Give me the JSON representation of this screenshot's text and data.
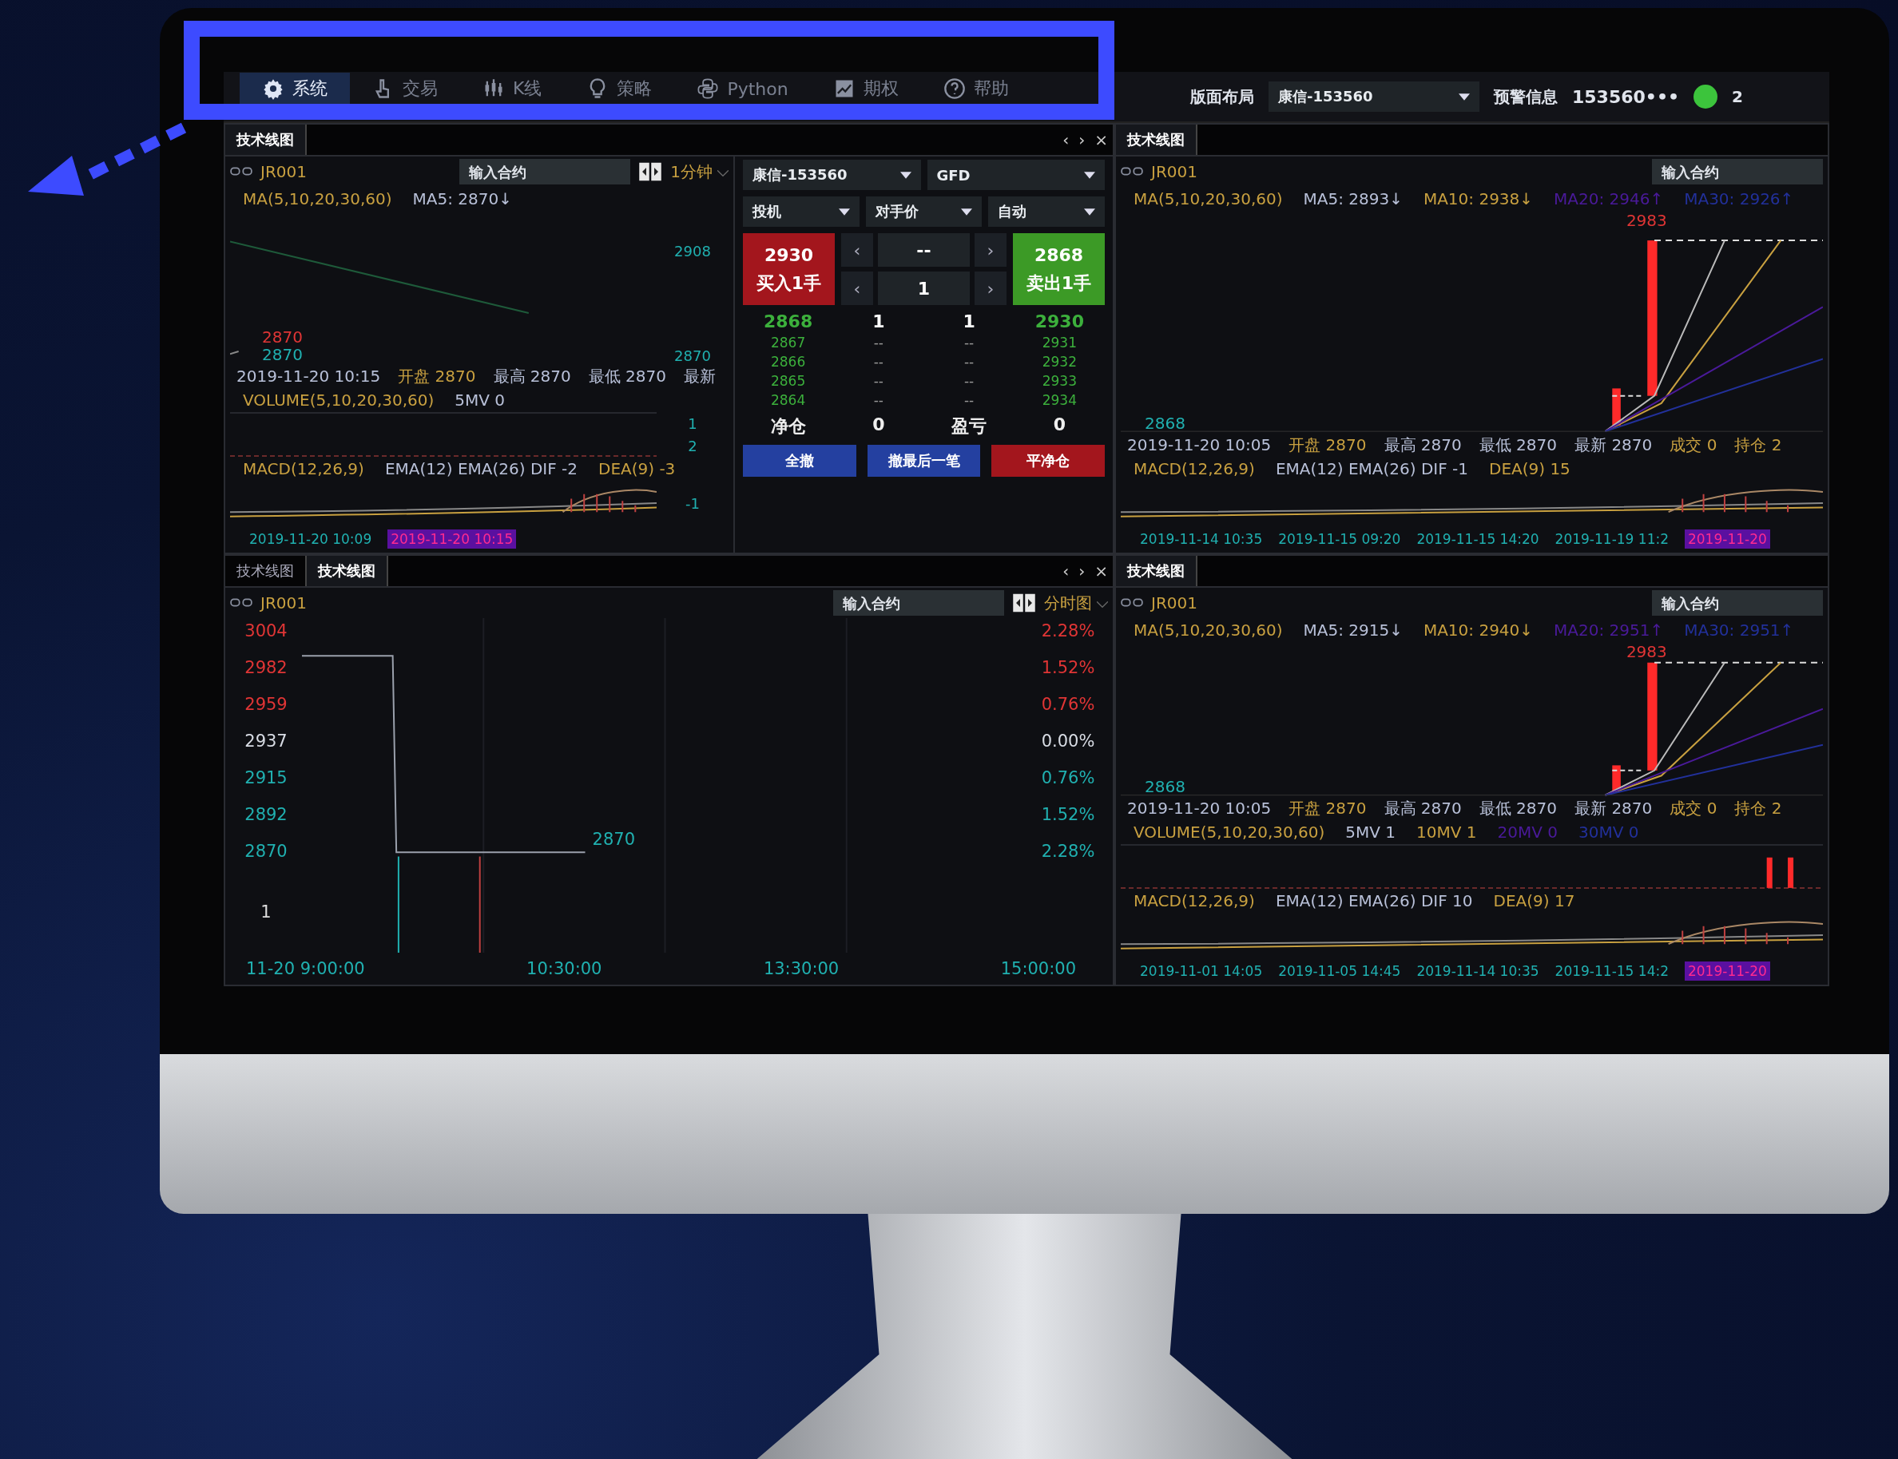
{
  "menu": [
    {
      "label": "系统",
      "selected": true
    },
    {
      "label": "交易",
      "selected": false
    },
    {
      "label": "K线",
      "selected": false
    },
    {
      "label": "策略",
      "selected": false
    },
    {
      "label": "Python",
      "selected": false
    },
    {
      "label": "期权",
      "selected": false
    },
    {
      "label": "帮助",
      "selected": false
    }
  ],
  "toolbar": {
    "layout": "版面布局",
    "account": "康信-153560",
    "alerts": "预警信息",
    "user": "153560•••",
    "overflow": "2"
  },
  "sections": [
    {
      "tabs": [
        {
          "label": "技术线图",
          "selected": true
        }
      ],
      "nav": [
        "‹",
        "›",
        "×"
      ],
      "chart": {
        "symbol": "JR001",
        "placeholder": "输入合约",
        "period": "1分钟",
        "legend": [
          {
            "text": "MA(5,10,20,30,60)",
            "color": "#c8a040"
          },
          {
            "text": "MA5: 2870↓",
            "color": "#b8c0d8"
          }
        ],
        "marks": [
          {
            "text": "2870",
            "color": "#e03535"
          },
          {
            "text": "2870",
            "color": "#20b0b0"
          }
        ],
        "price_axis": [
          "2908",
          "2870"
        ],
        "info": [
          {
            "text": "2019-11-20 10:15",
            "color": "#b8c0d8"
          },
          {
            "text": "开盘 2870",
            "color": "#c8a040"
          },
          {
            "text": "最高 2870",
            "color": "#b8c0d8"
          },
          {
            "text": "最低 2870",
            "color": "#b8c0d8"
          },
          {
            "text": "最新",
            "color": "#b8c0d8"
          }
        ],
        "volume_legend": [
          {
            "text": "VOLUME(5,10,20,30,60)",
            "color": "#c8a040"
          },
          {
            "text": "5MV 0",
            "color": "#b8c0d8"
          }
        ],
        "volume_axis": [
          "1",
          "2"
        ],
        "macd_legend": [
          {
            "text": "MACD(12,26,9)",
            "color": "#c8a040"
          },
          {
            "text": "EMA(12) EMA(26) DIF -2",
            "color": "#b8c0d8"
          },
          {
            "text": "DEA(9) -3",
            "color": "#c8a040"
          }
        ],
        "macd_axis": [
          "-1"
        ],
        "x_labels": [
          {
            "text": "2019-11-20 10:09",
            "selected": false
          },
          {
            "text": "2019-11-20 10:15",
            "selected": true
          }
        ]
      },
      "order": {
        "select_rows": [
          [
            "康信-153560",
            "GFD"
          ],
          [
            "投机",
            "对手价",
            "自动"
          ]
        ],
        "buy": {
          "price": "2930",
          "label": "买入1手"
        },
        "sell": {
          "price": "2868",
          "label": "卖出1手"
        },
        "steppers": [
          {
            "dec": "‹",
            "value": "--",
            "inc": "›"
          },
          {
            "dec": "‹",
            "value": "1",
            "inc": "›"
          }
        ],
        "depth": [
          [
            "2868",
            "1",
            "1",
            "2930"
          ],
          [
            "2867",
            "--",
            "--",
            "2931"
          ],
          [
            "2866",
            "--",
            "--",
            "2932"
          ],
          [
            "2865",
            "--",
            "--",
            "2933"
          ],
          [
            "2864",
            "--",
            "--",
            "2934"
          ]
        ],
        "position": [
          {
            "label": "净仓",
            "value": "0"
          },
          {
            "label": "盈亏",
            "value": "0"
          }
        ],
        "actions": [
          {
            "label": "全撤",
            "kind": "cancel"
          },
          {
            "label": "撤最后一笔",
            "kind": "cancel"
          },
          {
            "label": "平净仓",
            "kind": "close"
          }
        ]
      }
    },
    {
      "tabs": [
        {
          "label": "技术线图",
          "selected": true
        }
      ],
      "chart": {
        "symbol": "JR001",
        "placeholder": "输入合约",
        "legend": [
          {
            "text": "MA(5,10,20,30,60)",
            "color": "#c8a040"
          },
          {
            "text": "MA5: 2893↓",
            "color": "#b8c0d8"
          },
          {
            "text": "MA10: 2938↓",
            "color": "#c8a040"
          },
          {
            "text": "MA20: 2946↑",
            "color": "#4a1a9a"
          },
          {
            "text": "MA30: 2926↑",
            "color": "#22309a"
          }
        ],
        "marks": [
          {
            "text": "2983",
            "color": "#e03535"
          },
          {
            "text": "2868",
            "color": "#20b0b0"
          }
        ],
        "info": [
          {
            "text": "2019-11-20 10:05",
            "color": "#b8c0d8"
          },
          {
            "text": "开盘 2870",
            "color": "#c8a040"
          },
          {
            "text": "最高 2870",
            "color": "#b8c0d8"
          },
          {
            "text": "最低 2870",
            "color": "#b8c0d8"
          },
          {
            "text": "最新 2870",
            "color": "#b8c0d8"
          },
          {
            "text": "成交 0",
            "color": "#c8a040"
          },
          {
            "text": "持仓 2",
            "color": "#c8a040"
          }
        ],
        "macd_legend": [
          {
            "text": "MACD(12,26,9)",
            "color": "#c8a040"
          },
          {
            "text": "EMA(12) EMA(26) DIF -1",
            "color": "#b8c0d8"
          },
          {
            "text": "DEA(9) 15",
            "color": "#c8a040"
          }
        ],
        "x_labels": [
          {
            "text": "2019-11-14 10:35",
            "selected": false
          },
          {
            "text": "2019-11-15 09:20",
            "selected": false
          },
          {
            "text": "2019-11-15 14:20",
            "selected": false
          },
          {
            "text": "2019-11-19 11:2",
            "selected": false
          },
          {
            "text": "2019-11-20",
            "selected": true
          }
        ]
      }
    },
    {
      "tabs": [
        {
          "label": "技术线图",
          "selected": false
        },
        {
          "label": "技术线图",
          "selected": true
        }
      ],
      "nav": [
        "‹",
        "›",
        "×"
      ],
      "timeshare": {
        "symbol": "JR001",
        "placeholder": "输入合约",
        "period": "分时图",
        "left_axis": [
          {
            "text": "3004",
            "color": "#e03535"
          },
          {
            "text": "2982",
            "color": "#e03535"
          },
          {
            "text": "2959",
            "color": "#e03535"
          },
          {
            "text": "2937",
            "color": "#d8dce4"
          },
          {
            "text": "2915",
            "color": "#20b0b0"
          },
          {
            "text": "2892",
            "color": "#20b0b0"
          },
          {
            "text": "2870",
            "color": "#20b0b0"
          }
        ],
        "right_axis": [
          {
            "text": "2.28%",
            "color": "#e03535"
          },
          {
            "text": "1.52%",
            "color": "#e03535"
          },
          {
            "text": "0.76%",
            "color": "#e03535"
          },
          {
            "text": "0.00%",
            "color": "#d8dce4"
          },
          {
            "text": "0.76%",
            "color": "#20b0b0"
          },
          {
            "text": "1.52%",
            "color": "#20b0b0"
          },
          {
            "text": "2.28%",
            "color": "#20b0b0"
          }
        ],
        "last_mark": "2870",
        "volume_axis": "1",
        "x_labels": [
          "11-20 9:00:00",
          "10:30:00",
          "13:30:00",
          "15:00:00"
        ]
      }
    },
    {
      "tabs": [
        {
          "label": "技术线图",
          "selected": true
        }
      ],
      "chart": {
        "symbol": "JR001",
        "placeholder": "输入合约",
        "legend": [
          {
            "text": "MA(5,10,20,30,60)",
            "color": "#c8a040"
          },
          {
            "text": "MA5: 2915↓",
            "color": "#b8c0d8"
          },
          {
            "text": "MA10: 2940↓",
            "color": "#c8a040"
          },
          {
            "text": "MA20: 2951↑",
            "color": "#4a1a9a"
          },
          {
            "text": "MA30: 2951↑",
            "color": "#22309a"
          }
        ],
        "marks": [
          {
            "text": "2983",
            "color": "#e03535"
          },
          {
            "text": "2868",
            "color": "#20b0b0"
          }
        ],
        "info": [
          {
            "text": "2019-11-20 10:05",
            "color": "#b8c0d8"
          },
          {
            "text": "开盘 2870",
            "color": "#c8a040"
          },
          {
            "text": "最高 2870",
            "color": "#b8c0d8"
          },
          {
            "text": "最低 2870",
            "color": "#b8c0d8"
          },
          {
            "text": "最新 2870",
            "color": "#b8c0d8"
          },
          {
            "text": "成交 0",
            "color": "#c8a040"
          },
          {
            "text": "持仓 2",
            "color": "#c8a040"
          }
        ],
        "volume_legend": [
          {
            "text": "VOLUME(5,10,20,30,60)",
            "color": "#c8a040"
          },
          {
            "text": "5MV 1",
            "color": "#b8c0d8"
          },
          {
            "text": "10MV 1",
            "color": "#c8a040"
          },
          {
            "text": "20MV 0",
            "color": "#4a1a9a"
          },
          {
            "text": "30MV 0",
            "color": "#22309a"
          }
        ],
        "macd_legend": [
          {
            "text": "MACD(12,26,9)",
            "color": "#c8a040"
          },
          {
            "text": "EMA(12) EMA(26) DIF 10",
            "color": "#b8c0d8"
          },
          {
            "text": "DEA(9) 17",
            "color": "#c8a040"
          }
        ],
        "x_labels": [
          {
            "text": "2019-11-01 14:05",
            "selected": false
          },
          {
            "text": "2019-11-05 14:45",
            "selected": false
          },
          {
            "text": "2019-11-14 10:35",
            "selected": false
          },
          {
            "text": "2019-11-15 14:2",
            "selected": false
          },
          {
            "text": "2019-11-20",
            "selected": true
          }
        ]
      }
    }
  ]
}
